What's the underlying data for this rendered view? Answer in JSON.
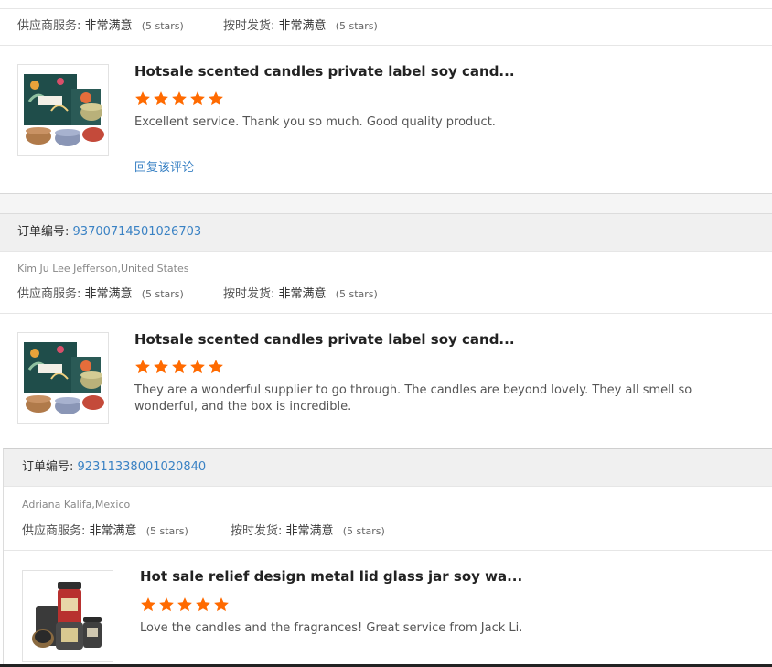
{
  "labels": {
    "supplier_service": "供应商服务:",
    "on_time_shipping": "按时发货:",
    "order_number": "订单编号:",
    "very_satisfied": "非常满意",
    "five_stars": "(5 stars)",
    "reply": "回复该评论"
  },
  "colors": {
    "star": "#ff6a00",
    "link": "#3a82c4"
  },
  "icons": {
    "star": "star-icon"
  },
  "reviews": [
    {
      "ratings": {
        "supplier_service": "非常满意",
        "supplier_stars": "(5 stars)",
        "shipping": "非常满意",
        "shipping_stars": "(5 stars)"
      },
      "product_title": "Hotsale scented candles private label soy cand...",
      "rating": 5,
      "comment": "Excellent service. Thank you so much. Good quality product.",
      "reply_label": "回复该评论"
    },
    {
      "order_label": "订单编号:",
      "order_number": "93700714501026703",
      "buyer": "Kim Ju Lee Jefferson,United States",
      "ratings": {
        "supplier_service": "非常满意",
        "supplier_stars": "(5 stars)",
        "shipping": "非常满意",
        "shipping_stars": "(5 stars)"
      },
      "product_title": "Hotsale scented candles private label soy cand...",
      "rating": 5,
      "comment": "They are a wonderful supplier to go through. The candles are beyond lovely. They all smell so wonderful, and the box is incredible."
    },
    {
      "order_label": "订单编号:",
      "order_number": "92311338001020840",
      "buyer": "Adriana Kalifa,Mexico",
      "ratings": {
        "supplier_service": "非常满意",
        "supplier_stars": "(5 stars)",
        "shipping": "非常满意",
        "shipping_stars": "(5 stars)"
      },
      "product_title": "Hot sale relief design metal lid glass jar soy wa...",
      "rating": 5,
      "comment": "Love the candles and the fragrances! Great service from Jack Li."
    }
  ]
}
